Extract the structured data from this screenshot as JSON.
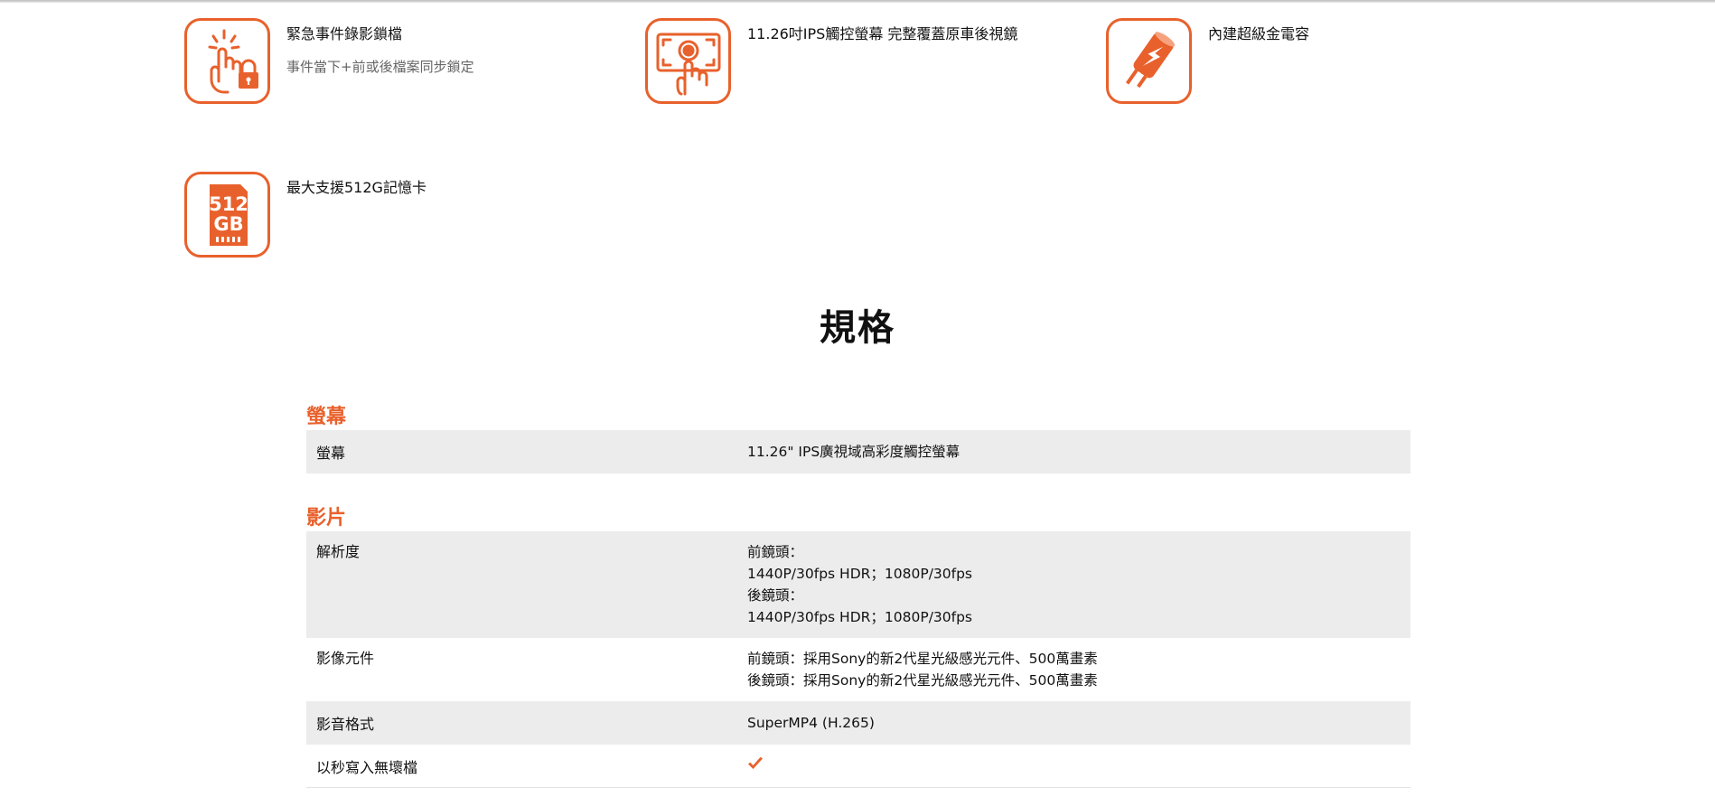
{
  "features": [
    {
      "icon": "touch-lock-icon",
      "title": "緊急事件錄影鎖檔",
      "subtitle": "事件當下+前或後檔案同步鎖定"
    },
    {
      "icon": "touchscreen-icon",
      "title": "11.26吋IPS觸控螢幕 完整覆蓋原車後視鏡",
      "subtitle": ""
    },
    {
      "icon": "supercapacitor-icon",
      "title": "內建超級金電容",
      "subtitle": ""
    },
    {
      "icon": "sd-card-512gb-icon",
      "title": "最大支援512G記憶卡",
      "subtitle": "",
      "icon_text_top": "512",
      "icon_text_bottom": "GB"
    }
  ],
  "spec_heading": "規格",
  "sections": [
    {
      "title": "螢幕",
      "rows": [
        {
          "key": "螢幕",
          "value_lines": [
            "11.26\" IPS廣視域高彩度觸控螢幕"
          ]
        }
      ]
    },
    {
      "title": "影片",
      "rows": [
        {
          "key": "解析度",
          "value_lines": [
            "前鏡頭：",
            "1440P/30fps HDR；1080P/30fps",
            "後鏡頭：",
            "1440P/30fps HDR；1080P/30fps"
          ]
        },
        {
          "key": "影像元件",
          "value_lines": [
            "前鏡頭：採用Sony的新2代星光級感光元件、500萬畫素",
            "後鏡頭：採用Sony的新2代星光級感光元件、500萬畫素"
          ]
        },
        {
          "key": "影音格式",
          "value_lines": [
            "SuperMP4 (H.265)"
          ]
        },
        {
          "key": "以秒寫入無壞檔",
          "value_icon": "check-icon"
        }
      ]
    }
  ],
  "colors": {
    "accent": "#e8612c",
    "row_shade": "#ececec"
  }
}
